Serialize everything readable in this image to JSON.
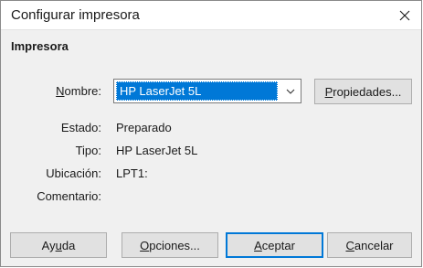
{
  "window": {
    "title": "Configurar impresora"
  },
  "section": {
    "title": "Impresora"
  },
  "name_row": {
    "label_prefix": "",
    "label_mnemonic": "N",
    "label_suffix": "ombre:",
    "selected": "HP LaserJet 5L"
  },
  "properties_button": {
    "mnemonic": "P",
    "rest": "ropiedades..."
  },
  "info": {
    "status_label": "Estado:",
    "status_value": "Preparado",
    "type_label": "Tipo:",
    "type_value": "HP LaserJet 5L",
    "location_label": "Ubicación:",
    "location_value": "LPT1:",
    "comment_label": "Comentario:",
    "comment_value": ""
  },
  "buttons": {
    "help": {
      "before": "Ay",
      "mnemonic": "u",
      "after": "da"
    },
    "options": {
      "before": "",
      "mnemonic": "O",
      "after": "pciones..."
    },
    "accept": {
      "before": "",
      "mnemonic": "A",
      "after": "ceptar"
    },
    "cancel": {
      "before": "",
      "mnemonic": "C",
      "after": "ancelar"
    }
  },
  "colors": {
    "accent": "#0078d7",
    "background": "#f0f0f0"
  },
  "icons": {
    "close": "close-icon",
    "dropdown": "chevron-down-icon"
  }
}
